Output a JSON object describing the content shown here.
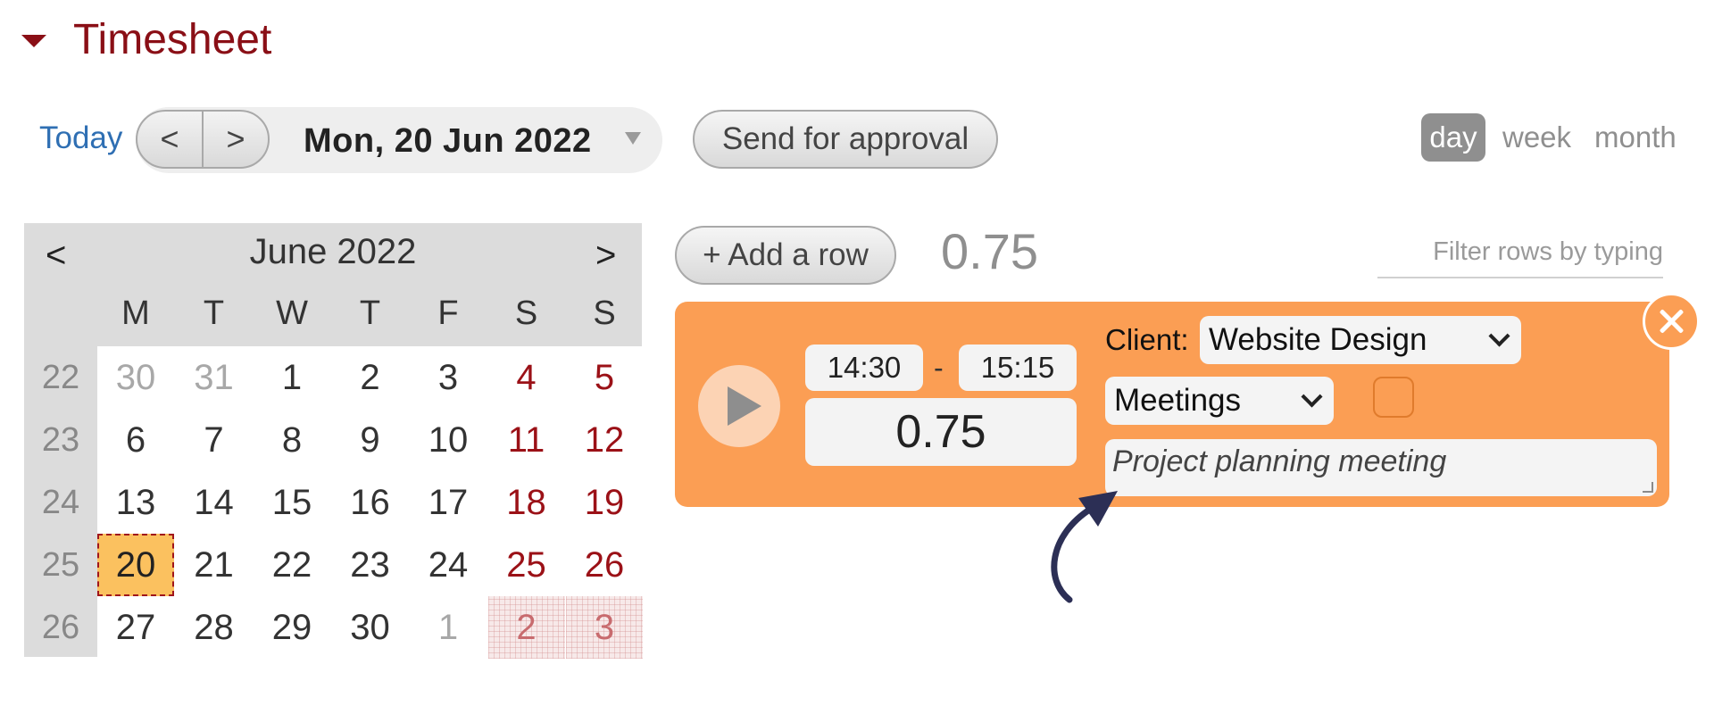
{
  "header": {
    "title": "Timesheet"
  },
  "toolbar": {
    "today": "Today",
    "prev": "<",
    "next": ">",
    "date": "Mon, 20 Jun 2022",
    "send": "Send for approval",
    "views": [
      "day",
      "week",
      "month"
    ],
    "active_view": "day"
  },
  "calendar": {
    "title": "June 2022",
    "prev": "<",
    "next": ">",
    "weekdays": [
      "M",
      "T",
      "W",
      "T",
      "F",
      "S",
      "S"
    ],
    "weeks": [
      {
        "num": "22",
        "days": [
          "30",
          "31",
          "1",
          "2",
          "3",
          "4",
          "5"
        ]
      },
      {
        "num": "23",
        "days": [
          "6",
          "7",
          "8",
          "9",
          "10",
          "11",
          "12"
        ]
      },
      {
        "num": "24",
        "days": [
          "13",
          "14",
          "15",
          "16",
          "17",
          "18",
          "19"
        ]
      },
      {
        "num": "25",
        "days": [
          "20",
          "21",
          "22",
          "23",
          "24",
          "25",
          "26"
        ]
      },
      {
        "num": "26",
        "days": [
          "27",
          "28",
          "29",
          "30",
          "1",
          "2",
          "3"
        ]
      }
    ],
    "selected": "20"
  },
  "rows": {
    "add_row": "+ Add a row",
    "total": "0.75",
    "filter_placeholder": "Filter rows by typing"
  },
  "entry": {
    "start": "14:30",
    "dash": "-",
    "end": "15:15",
    "duration": "0.75",
    "client_label": "Client:",
    "client": "Website Design",
    "activity": "Meetings",
    "notes": "Project planning meeting"
  },
  "colors": {
    "accent": "#8a0f16",
    "entry_bg": "#fb9e54",
    "today_bg": "#fbc15f",
    "link": "#2f6fb3",
    "arrow": "#2c2f55"
  },
  "icons": [
    "collapse-triangle-icon",
    "play-icon",
    "close-icon",
    "chevron-down-icon",
    "resize-grip-icon",
    "curved-arrow-icon"
  ]
}
